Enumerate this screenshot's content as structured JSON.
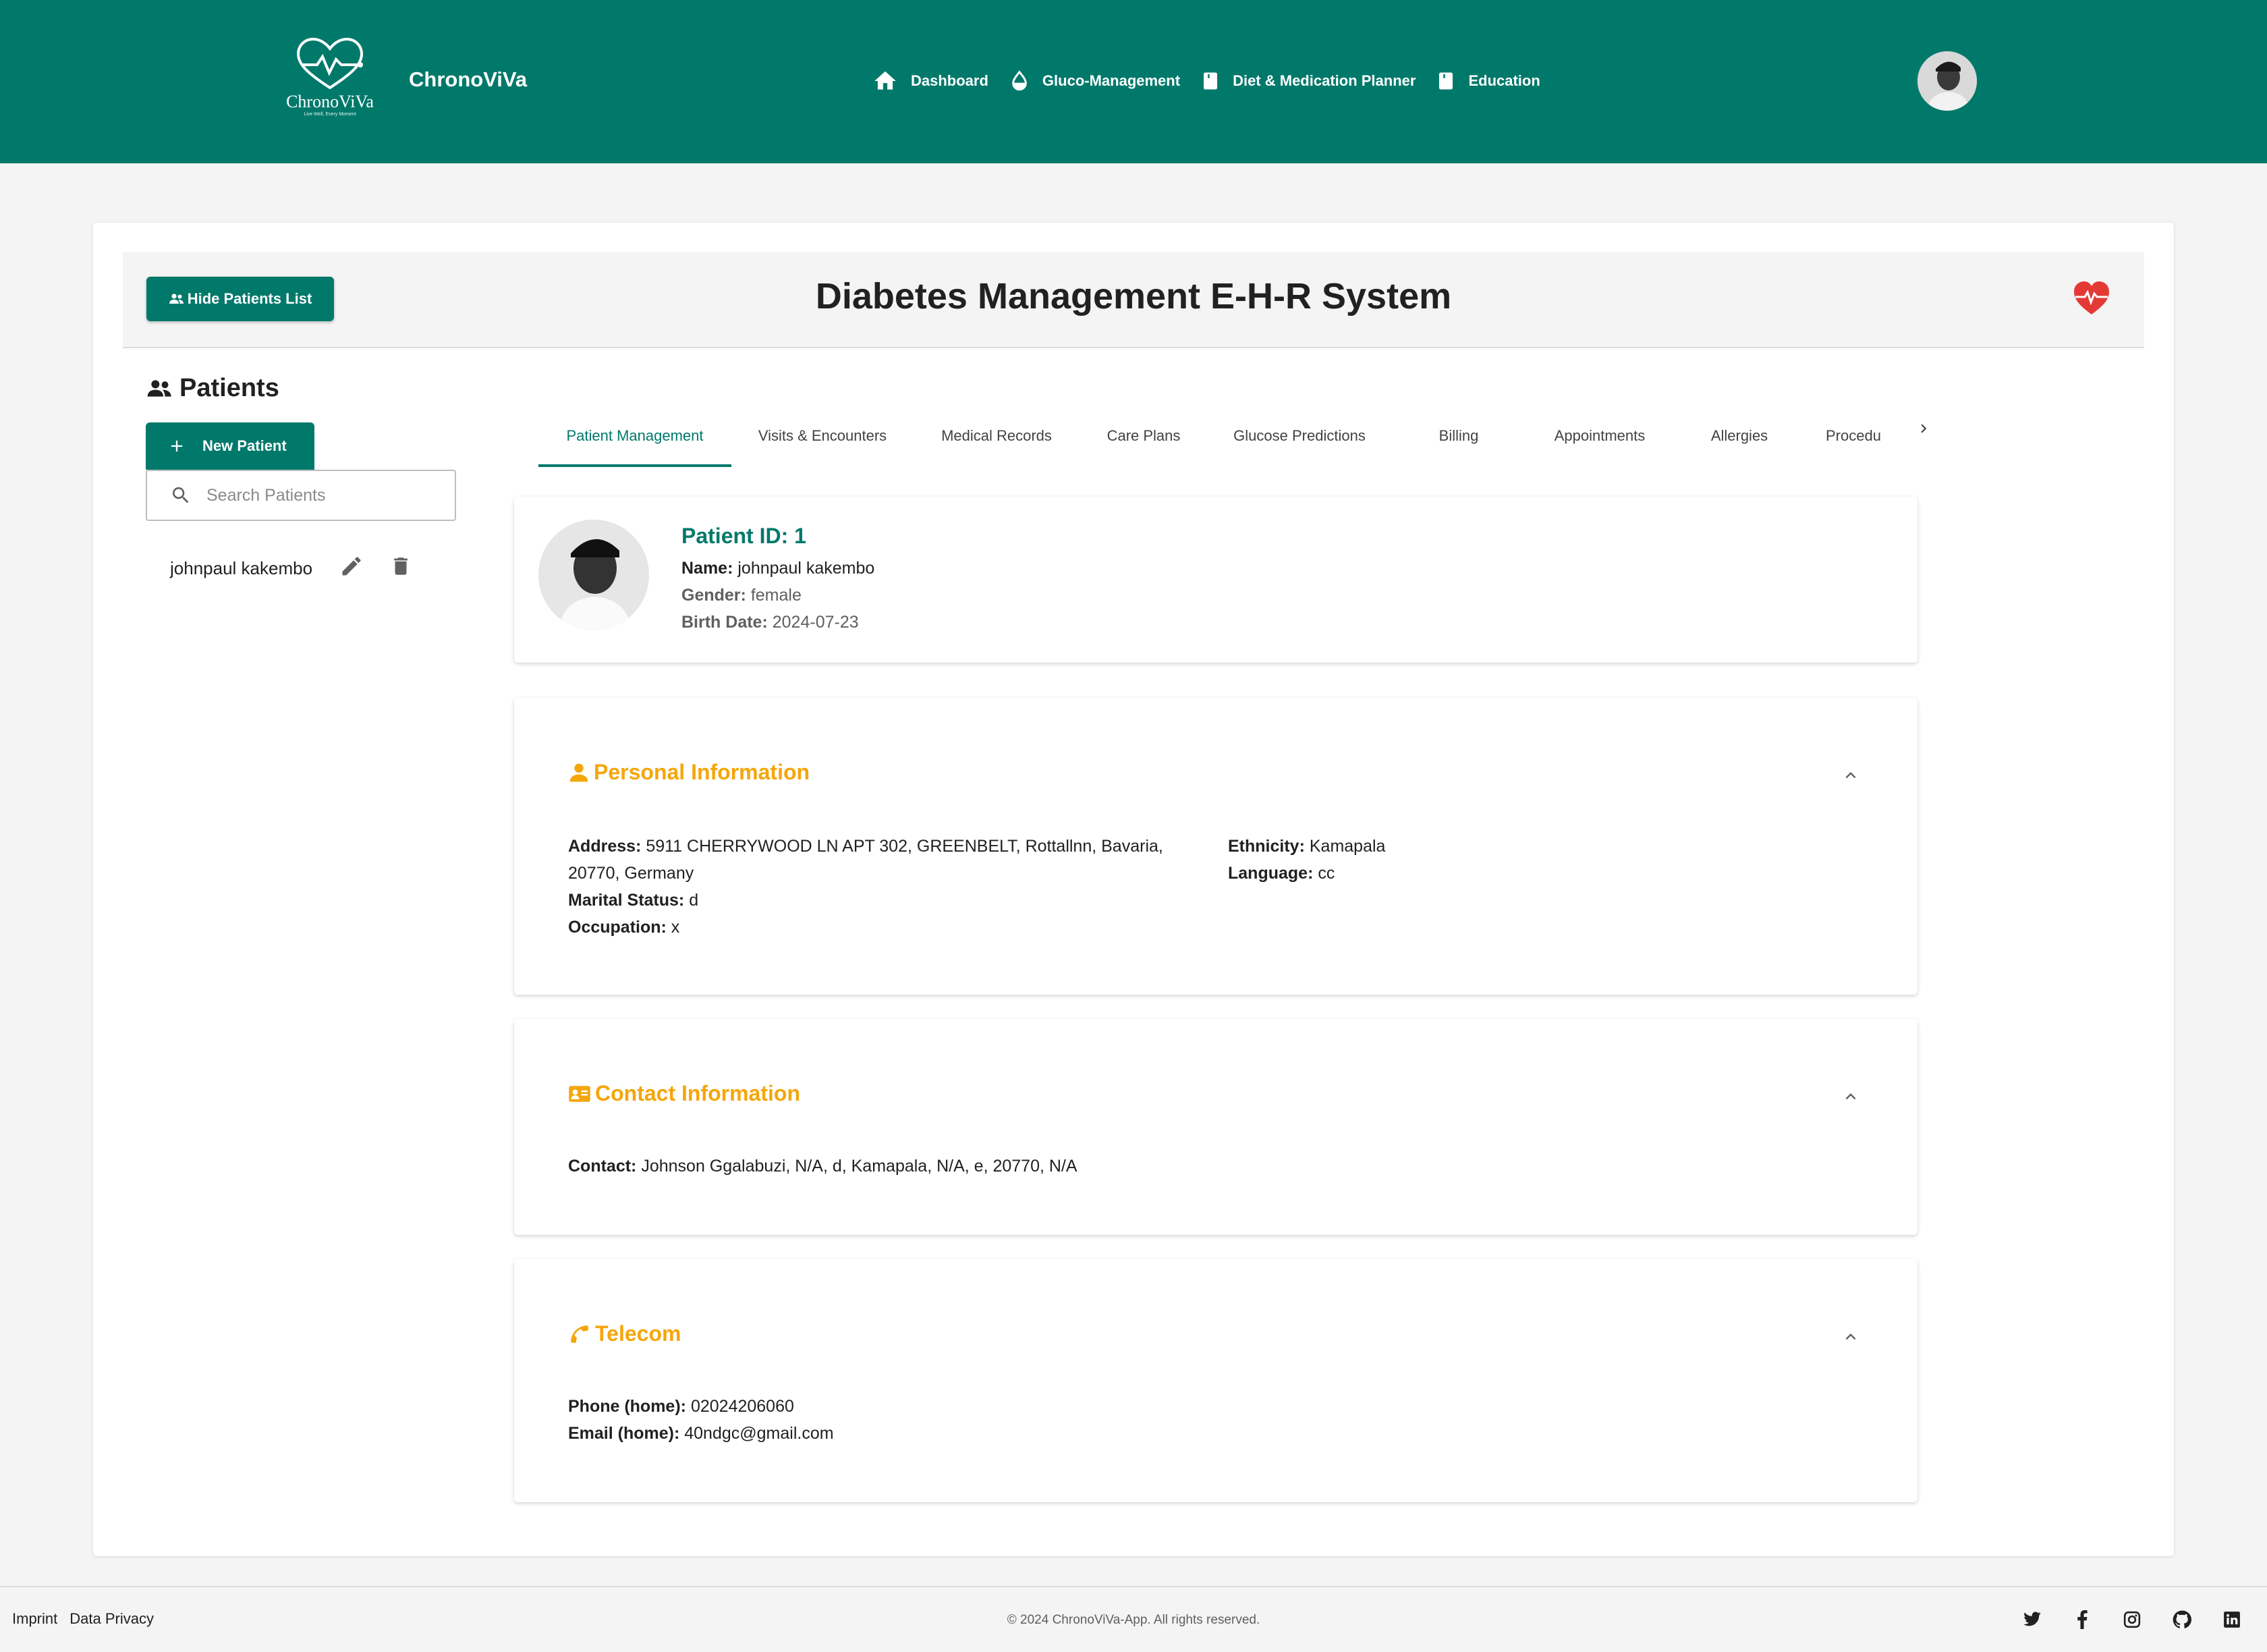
{
  "header": {
    "logo_text": "ChronoViVa",
    "logo_tagline": "Live Well, Every Moment",
    "brand": "ChronoViVa",
    "nav": [
      {
        "label": "Dashboard",
        "icon": "home-icon"
      },
      {
        "label": "Gluco-Management",
        "icon": "droplet-icon"
      },
      {
        "label": "Diet & Medication Planner",
        "icon": "book-icon"
      },
      {
        "label": "Education",
        "icon": "book-icon"
      }
    ]
  },
  "card": {
    "hide_button": "Hide Patients List",
    "title": "Diabetes Management E-H-R System"
  },
  "sidebar": {
    "heading": "Patients",
    "new_button": "New Patient",
    "search_placeholder": "Search Patients",
    "patients": [
      {
        "name": "johnpaul kakembo"
      }
    ]
  },
  "tabs": [
    {
      "label": "Patient Management",
      "active": true
    },
    {
      "label": "Visits & Encounters"
    },
    {
      "label": "Medical Records"
    },
    {
      "label": "Care Plans"
    },
    {
      "label": "Glucose Predictions"
    },
    {
      "label": "Billing"
    },
    {
      "label": "Appointments"
    },
    {
      "label": "Allergies"
    },
    {
      "label": "Procedu"
    }
  ],
  "patient": {
    "id_label": "Patient ID: 1",
    "name_label": "Name:",
    "name": "johnpaul kakembo",
    "gender_label": "Gender:",
    "gender": "female",
    "birth_label": "Birth Date:",
    "birth": "2024-07-23"
  },
  "personal": {
    "title": "Personal Information",
    "address_label": "Address:",
    "address_line1": "5911 CHERRYWOOD LN APT 302, GREENBELT, Rottallnn, Bavaria,",
    "address_line2": "20770, Germany",
    "marital_label": "Marital Status:",
    "marital": "d",
    "occupation_label": "Occupation:",
    "occupation": "x",
    "ethnicity_label": "Ethnicity:",
    "ethnicity": "Kamapala",
    "language_label": "Language:",
    "language": "cc"
  },
  "contact": {
    "title": "Contact Information",
    "label": "Contact:",
    "value": "Johnson Ggalabuzi, N/A, d, Kamapala, N/A, e, 20770, N/A"
  },
  "telecom": {
    "title": "Telecom",
    "phone_label": "Phone (home):",
    "phone": "02024206060",
    "email_label": "Email (home):",
    "email": "40ndgc@gmail.com"
  },
  "footer": {
    "imprint": "Imprint",
    "privacy": "Data Privacy",
    "copyright": "© 2024 ChronoViVa-App. All rights reserved.",
    "socials": [
      "twitter-icon",
      "facebook-icon",
      "instagram-icon",
      "github-icon",
      "linkedin-icon"
    ]
  },
  "colors": {
    "primary": "#00796b",
    "accent": "#f5a60b",
    "heart": "#e53935"
  }
}
